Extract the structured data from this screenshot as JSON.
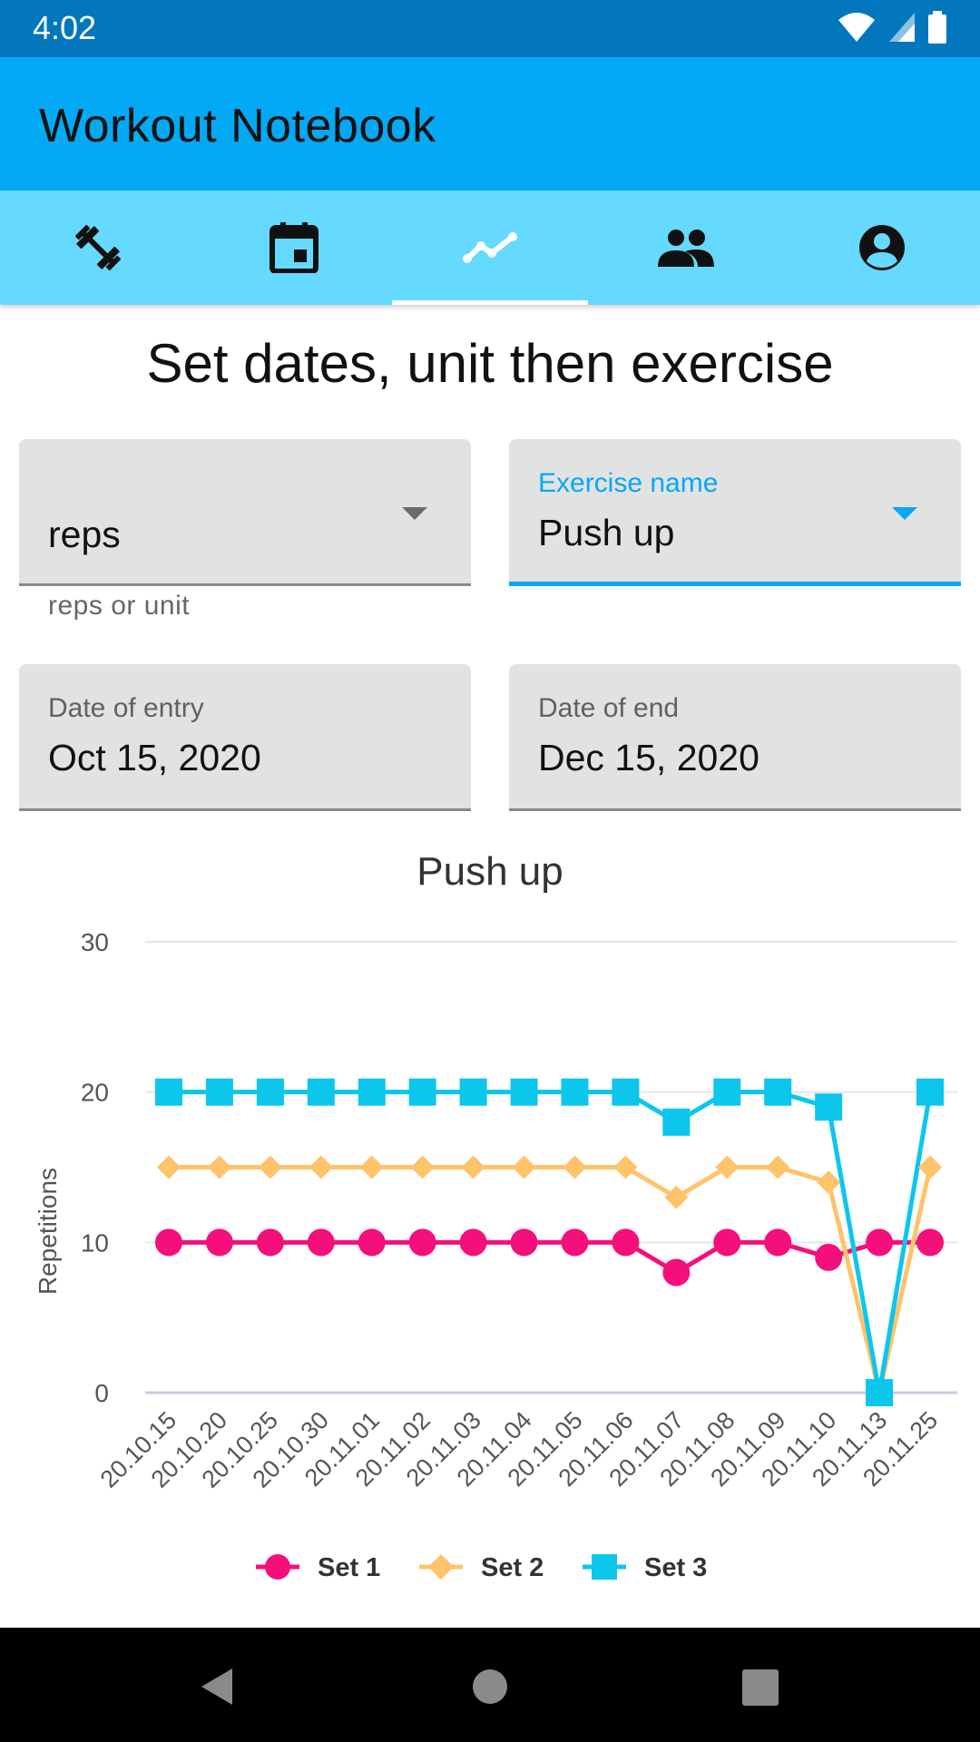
{
  "status_bar": {
    "time": "4:02",
    "icons": [
      "wifi-icon",
      "signal-icon",
      "battery-icon"
    ]
  },
  "app_bar": {
    "title": "Workout Notebook"
  },
  "tabs": [
    {
      "name": "exercises",
      "icon": "dumbbell-icon",
      "active": false
    },
    {
      "name": "calendar",
      "icon": "calendar-icon",
      "active": false
    },
    {
      "name": "statistics",
      "icon": "trend-line-icon",
      "active": true
    },
    {
      "name": "friends",
      "icon": "people-icon",
      "active": false
    },
    {
      "name": "profile",
      "icon": "account-circle-icon",
      "active": false
    }
  ],
  "heading": "Set dates, unit then exercise",
  "form": {
    "unit": {
      "value": "reps",
      "helper": "reps or unit"
    },
    "exercise": {
      "label": "Exercise name",
      "value": "Push up"
    },
    "date_entry": {
      "label": "Date of entry",
      "value": "Oct 15, 2020"
    },
    "date_end": {
      "label": "Date of end",
      "value": "Dec 15, 2020"
    }
  },
  "colors": {
    "accent": "#03a9f4",
    "app_bar": "#03a9f4",
    "status_bar": "#0277bd",
    "tab_bar": "#66d9ff"
  },
  "chart_data": {
    "type": "line",
    "title": "Push up",
    "xlabel": "",
    "ylabel": "Repetitions",
    "ylim": [
      0,
      30
    ],
    "yticks": [
      "0",
      "10",
      "20",
      "30"
    ],
    "grid": true,
    "legend_position": "bottom",
    "categories": [
      "20.10.15",
      "20.10.20",
      "20.10.25",
      "20.10.30",
      "20.11.01",
      "20.11.02",
      "20.11.03",
      "20.11.04",
      "20.11.05",
      "20.11.06",
      "20.11.07",
      "20.11.08",
      "20.11.09",
      "20.11.10",
      "20.11.13",
      "20.11.25"
    ],
    "series": [
      {
        "name": "Set 1",
        "color": "#f50f7a",
        "marker": "circle",
        "values": [
          10,
          10,
          10,
          10,
          10,
          10,
          10,
          10,
          10,
          10,
          8,
          10,
          10,
          9,
          10,
          10
        ]
      },
      {
        "name": "Set 2",
        "color": "#ffc36b",
        "marker": "diamond",
        "values": [
          15,
          15,
          15,
          15,
          15,
          15,
          15,
          15,
          15,
          15,
          13,
          15,
          15,
          14,
          0,
          15
        ]
      },
      {
        "name": "Set 3",
        "color": "#0cc6ec",
        "marker": "square",
        "values": [
          20,
          20,
          20,
          20,
          20,
          20,
          20,
          20,
          20,
          20,
          18,
          20,
          20,
          19,
          0,
          20
        ]
      }
    ]
  }
}
